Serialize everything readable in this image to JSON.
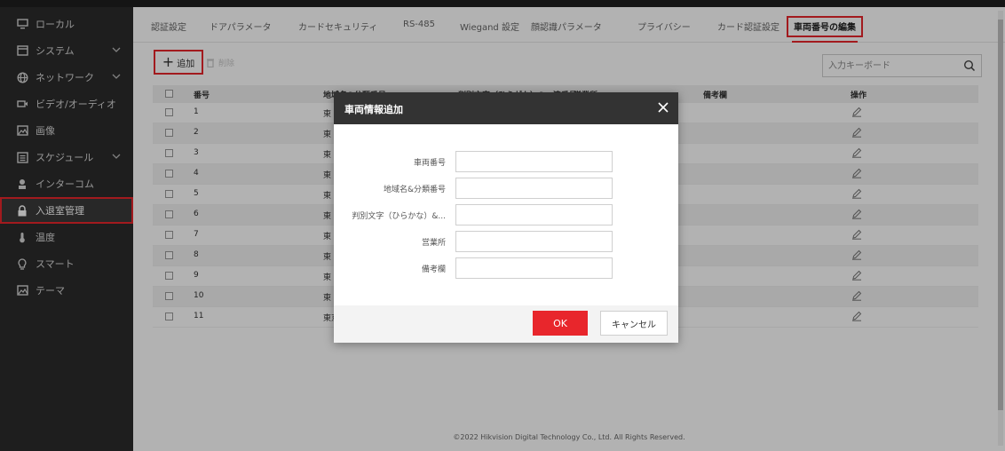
{
  "sidebar": {
    "items": [
      {
        "label": "ローカル",
        "icon": "monitor-icon"
      },
      {
        "label": "システム",
        "icon": "system-icon"
      },
      {
        "label": "ネットワーク",
        "icon": "globe-icon"
      },
      {
        "label": "ビデオ/オーディオ",
        "icon": "video-icon"
      },
      {
        "label": "画像",
        "icon": "image-icon"
      },
      {
        "label": "スケジュール",
        "icon": "schedule-icon"
      },
      {
        "label": "インターコム",
        "icon": "intercom-icon"
      },
      {
        "label": "入退室管理",
        "icon": "lock-icon"
      },
      {
        "label": "温度",
        "icon": "thermometer-icon"
      },
      {
        "label": "スマート",
        "icon": "bulb-icon"
      },
      {
        "label": "テーマ",
        "icon": "theme-icon"
      }
    ]
  },
  "tabs": [
    {
      "label": "認証設定"
    },
    {
      "label": "ドアパラメータ"
    },
    {
      "label": "カードセキュリティ"
    },
    {
      "label": "RS-485"
    },
    {
      "label": "Wiegand 設定"
    },
    {
      "label": "顔認識パラメータ"
    },
    {
      "label": "プライバシー"
    },
    {
      "label": "カード認証設定"
    },
    {
      "label": "車両番号の編集"
    }
  ],
  "toolbar": {
    "add_label": "追加",
    "delete_label": "削除",
    "search_placeholder": "入力キーボード"
  },
  "table": {
    "headers": {
      "num": "番号",
      "area": "地域名&分類番号",
      "chars": "判別文字（ひらがな）&一連番号",
      "office": "営業所",
      "note": "備考欄",
      "op": "操作"
    },
    "rows": [
      {
        "num": "1",
        "area": "東"
      },
      {
        "num": "2",
        "area": "東"
      },
      {
        "num": "3",
        "area": "東"
      },
      {
        "num": "4",
        "area": "東"
      },
      {
        "num": "5",
        "area": "東"
      },
      {
        "num": "6",
        "area": "東"
      },
      {
        "num": "7",
        "area": "東"
      },
      {
        "num": "8",
        "area": "東"
      },
      {
        "num": "9",
        "area": "東"
      },
      {
        "num": "10",
        "area": "東"
      },
      {
        "num": "11",
        "area": "東京"
      }
    ]
  },
  "dialog": {
    "title": "車両情報追加",
    "fields": [
      {
        "label": "車両番号",
        "value": ""
      },
      {
        "label": "地域名&分類番号",
        "value": ""
      },
      {
        "label": "判別文字（ひらかな）&...",
        "value": ""
      },
      {
        "label": "営業所",
        "value": ""
      },
      {
        "label": "備考欄",
        "value": ""
      }
    ],
    "ok_label": "OK",
    "cancel_label": "キャンセル"
  },
  "footer": {
    "copyright": "©2022 Hikvision Digital Technology Co., Ltd. All Rights Reserved."
  },
  "colors": {
    "accent": "#e8262c",
    "sidebar_bg": "#2b2b2b",
    "dialog_header": "#333333"
  }
}
